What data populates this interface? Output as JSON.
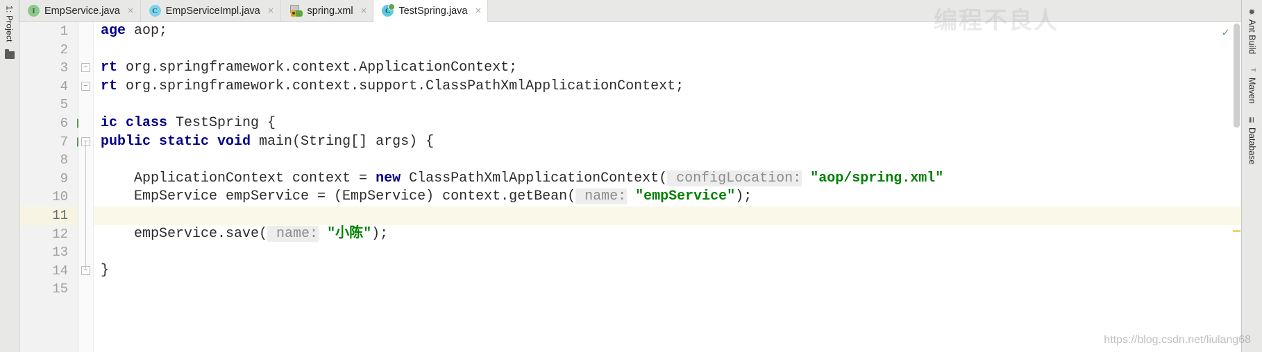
{
  "window": {
    "left_tool_strip": {
      "project_label": "1: Project",
      "folder_icon": "folder-icon"
    },
    "right_tool_strip": {
      "items": [
        {
          "label": "Ant Build",
          "icon": "ant-icon"
        },
        {
          "label": "Maven",
          "icon": "maven-icon"
        },
        {
          "label": "Database",
          "icon": "database-icon"
        }
      ]
    }
  },
  "tabs": [
    {
      "label": "EmpService.java",
      "icon": "interface-icon",
      "close": "×",
      "active": false
    },
    {
      "label": "EmpServiceImpl.java",
      "icon": "class-icon",
      "close": "×",
      "active": false
    },
    {
      "label": "spring.xml",
      "icon": "spring-bean-icon",
      "close": "×",
      "active": false
    },
    {
      "label": "TestSpring.java",
      "icon": "class-run-icon",
      "close": "×",
      "active": true
    }
  ],
  "editor": {
    "caret_line": 11,
    "line_numbers": [
      "1",
      "2",
      "3",
      "4",
      "5",
      "6",
      "7",
      "8",
      "9",
      "10",
      "11",
      "12",
      "13",
      "14",
      "15"
    ],
    "run_gutter_lines": [
      6,
      7
    ],
    "lines": [
      {
        "n": 1,
        "tokens": [
          {
            "t": "age",
            "c": "kw"
          },
          {
            "t": " aop;",
            "c": "plain"
          }
        ]
      },
      {
        "n": 2,
        "tokens": []
      },
      {
        "n": 3,
        "tokens": [
          {
            "t": "rt",
            "c": "kw"
          },
          {
            "t": " org.springframework.context.ApplicationContext;",
            "c": "plain"
          }
        ]
      },
      {
        "n": 4,
        "tokens": [
          {
            "t": "rt",
            "c": "kw"
          },
          {
            "t": " org.springframework.context.support.ClassPathXmlApplicationContext;",
            "c": "plain"
          }
        ]
      },
      {
        "n": 5,
        "tokens": []
      },
      {
        "n": 6,
        "tokens": [
          {
            "t": "ic class",
            "c": "kw"
          },
          {
            "t": " TestSpring {",
            "c": "plain"
          }
        ]
      },
      {
        "n": 7,
        "tokens": [
          {
            "t": "public static void",
            "c": "kw"
          },
          {
            "t": " main(String[] args) {",
            "c": "plain"
          }
        ]
      },
      {
        "n": 8,
        "tokens": []
      },
      {
        "n": 9,
        "tokens": [
          {
            "t": "    ApplicationContext context = ",
            "c": "plain"
          },
          {
            "t": "new",
            "c": "kw"
          },
          {
            "t": " ClassPathXmlApplicationContext(",
            "c": "plain"
          },
          {
            "t": " configLocation:",
            "c": "hint"
          },
          {
            "t": " ",
            "c": "plain"
          },
          {
            "t": "\"aop/spring.xml\"",
            "c": "str"
          }
        ]
      },
      {
        "n": 10,
        "tokens": [
          {
            "t": "    EmpService empService = (EmpService) context.getBean(",
            "c": "plain"
          },
          {
            "t": " name:",
            "c": "hint"
          },
          {
            "t": " ",
            "c": "plain"
          },
          {
            "t": "\"empService\"",
            "c": "str"
          },
          {
            "t": ");",
            "c": "plain"
          }
        ]
      },
      {
        "n": 11,
        "tokens": []
      },
      {
        "n": 12,
        "tokens": [
          {
            "t": "    empService.save(",
            "c": "plain"
          },
          {
            "t": " name:",
            "c": "hint"
          },
          {
            "t": " ",
            "c": "plain"
          },
          {
            "t": "\"小陈\"",
            "c": "str"
          },
          {
            "t": ");",
            "c": "plain"
          }
        ]
      },
      {
        "n": 13,
        "tokens": []
      },
      {
        "n": 14,
        "tokens": [
          {
            "t": "}",
            "c": "plain"
          }
        ]
      },
      {
        "n": 15,
        "tokens": []
      }
    ],
    "fold_markers": [
      {
        "line": 3,
        "glyph": "−"
      },
      {
        "line": 4,
        "glyph": "−"
      },
      {
        "line": 7,
        "glyph": "−"
      },
      {
        "line": 14,
        "glyph": "−"
      }
    ],
    "inspection_arrow": "✓"
  },
  "watermarks": {
    "top": "编程不良人",
    "bottom": "https://blog.csdn.net/liulang68"
  },
  "colors": {
    "keyword": "#00008c",
    "string": "#008000",
    "hint_text": "#8c8c8c",
    "hint_bg": "#ededed",
    "caret_line_bg": "#faf8e8",
    "gutter_bg": "#f2f2f2",
    "tab_bar_bg": "#e8e8e7",
    "run_arrow": "#4f9a4c"
  }
}
